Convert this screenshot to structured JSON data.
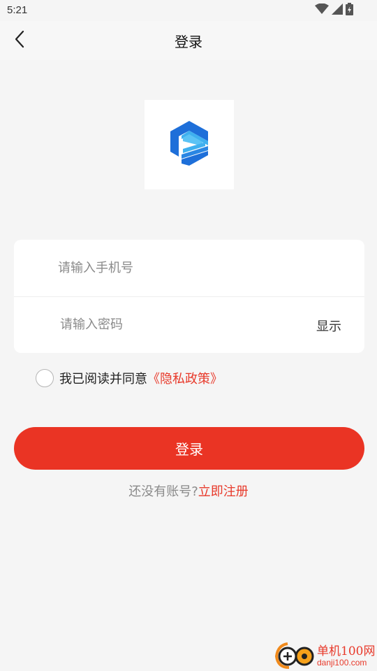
{
  "status_bar": {
    "time": "5:21",
    "icons": [
      "wifi-icon",
      "signal-icon",
      "battery-icon"
    ]
  },
  "nav": {
    "back_icon": "chevron-left-icon",
    "title": "登录"
  },
  "logo": {
    "icon": "app-logo-icon"
  },
  "form": {
    "phone_placeholder": "请输入手机号",
    "phone_value": "",
    "password_placeholder": "请输入密码",
    "password_value": "",
    "show_label": "显示"
  },
  "agreement": {
    "checked": false,
    "text": "我已阅读并同意",
    "link": "《隐私政策》"
  },
  "login_button_label": "登录",
  "register": {
    "prompt": "还没有账号?",
    "link": "立即注册"
  },
  "watermark": {
    "name": "单机100网",
    "url": "danji100.com"
  },
  "colors": {
    "accent": "#ea3424",
    "background": "#f5f5f5",
    "logo_blue": "#1e6fd9",
    "logo_light": "#3fb0ef"
  }
}
